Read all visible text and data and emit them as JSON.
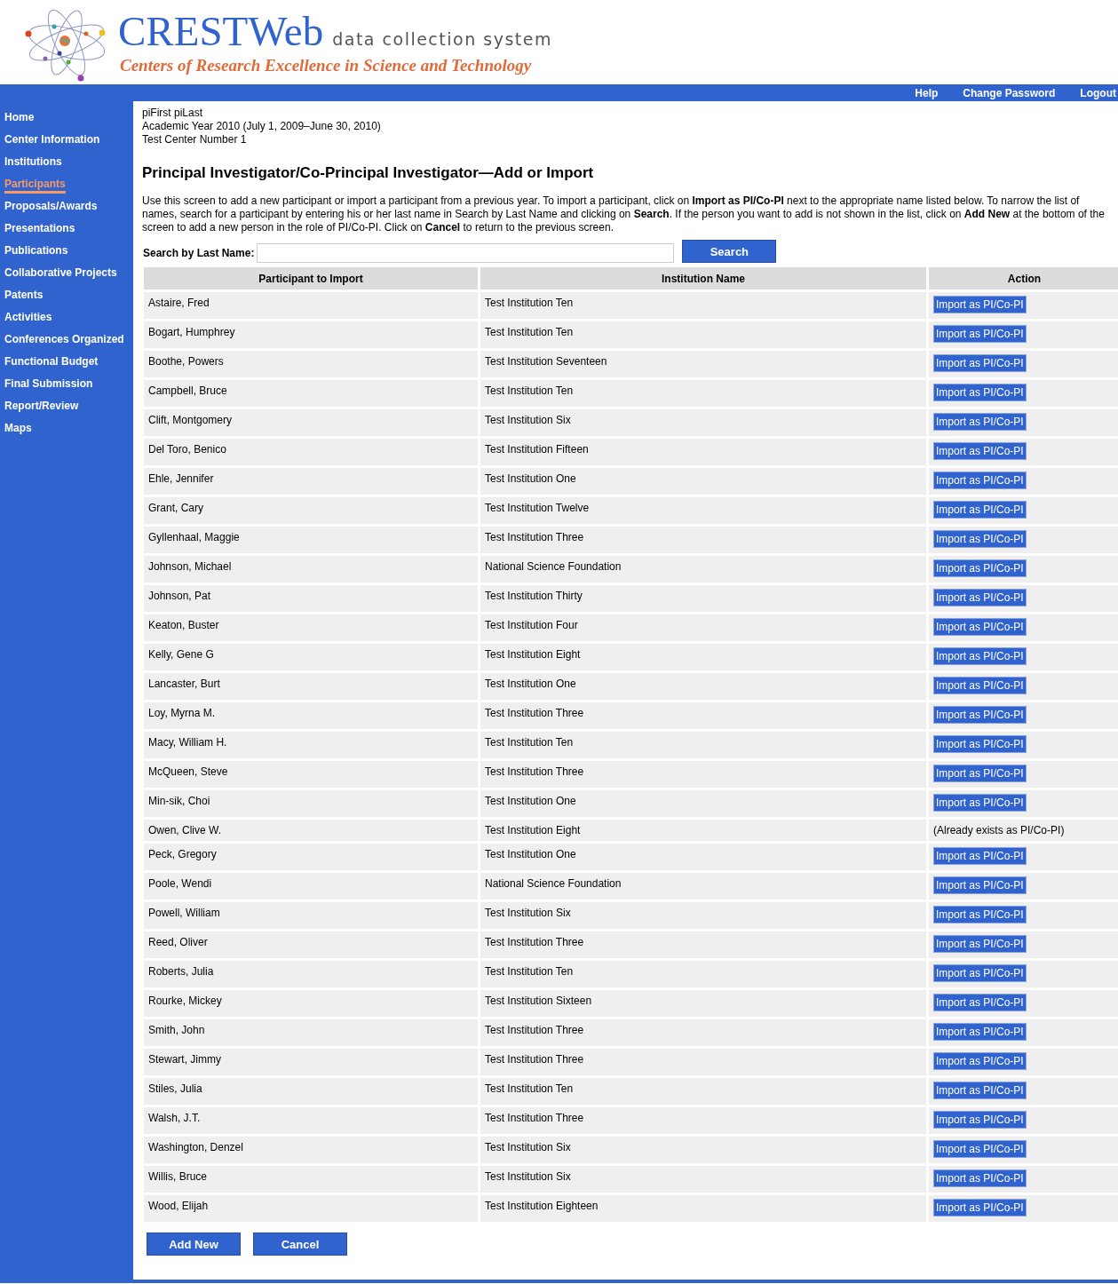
{
  "header": {
    "title": "CRESTWeb",
    "subtitle": "data collection system",
    "tagline": "Centers of Research Excellence in Science and Technology"
  },
  "top_links": [
    "Help",
    "Change Password",
    "Logout"
  ],
  "sidebar": {
    "items": [
      {
        "label": "Home",
        "selected": false
      },
      {
        "label": "Center Information",
        "selected": false
      },
      {
        "label": "Institutions",
        "selected": false
      },
      {
        "label": "Participants",
        "selected": true
      },
      {
        "label": "Proposals/Awards",
        "selected": false
      },
      {
        "label": "Presentations",
        "selected": false
      },
      {
        "label": "Publications",
        "selected": false
      },
      {
        "label": "Collaborative Projects",
        "selected": false
      },
      {
        "label": "Patents",
        "selected": false
      },
      {
        "label": "Activities",
        "selected": false
      },
      {
        "label": "Conferences Organized",
        "selected": false
      },
      {
        "label": "Functional Budget",
        "selected": false
      },
      {
        "label": "Final Submission",
        "selected": false
      },
      {
        "label": "Report/Review",
        "selected": false
      },
      {
        "label": "Maps",
        "selected": false
      }
    ]
  },
  "context": [
    "piFirst piLast",
    "Academic Year 2010 (July 1, 2009–June 30, 2010)",
    "Test Center Number 1"
  ],
  "page_title": "Principal Investigator/Co-Principal Investigator—Add or Import",
  "instructions": "Use this screen to add a new participant or import a participant from a previous year. To import a participant, click on **Import as PI/Co-PI** next to the appropriate name listed below. To narrow the list of names, search for a participant by entering his or her last name in Search by Last Name and clicking on **Search**. If the person you want to add is not shown in the list, click on **Add New** at the bottom of the screen to add a new person in the role of PI/Co-PI. Click on **Cancel** to return to the previous screen.",
  "search": {
    "label": "Search by Last Name:",
    "button": "Search"
  },
  "table": {
    "columns": [
      "Participant to Import",
      "Institution Name",
      "Action"
    ],
    "rows": [
      {
        "name": "Astaire, Fred",
        "institution": "Test Institution Ten",
        "kind": "button",
        "action": "Import as PI/Co-PI"
      },
      {
        "name": "Bogart, Humphrey",
        "institution": "Test Institution Ten",
        "kind": "button",
        "action": "Import as PI/Co-PI"
      },
      {
        "name": "Boothe, Powers",
        "institution": "Test Institution Seventeen",
        "kind": "button",
        "action": "Import as PI/Co-PI"
      },
      {
        "name": "Campbell, Bruce",
        "institution": "Test Institution Ten",
        "kind": "button",
        "action": "Import as PI/Co-PI"
      },
      {
        "name": "Clift, Montgomery",
        "institution": "Test Institution Six",
        "kind": "button",
        "action": "Import as PI/Co-PI"
      },
      {
        "name": "Del Toro, Benico",
        "institution": "Test Institution Fifteen",
        "kind": "button",
        "action": "Import as PI/Co-PI"
      },
      {
        "name": "Ehle, Jennifer",
        "institution": "Test Institution One",
        "kind": "button",
        "action": "Import as PI/Co-PI"
      },
      {
        "name": "Grant, Cary",
        "institution": "Test Institution Twelve",
        "kind": "button",
        "action": "Import as PI/Co-PI"
      },
      {
        "name": "Gyllenhaal, Maggie",
        "institution": "Test Institution Three",
        "kind": "button",
        "action": "Import as PI/Co-PI"
      },
      {
        "name": "Johnson, Michael",
        "institution": "National Science Foundation",
        "kind": "button",
        "action": "Import as PI/Co-PI"
      },
      {
        "name": "Johnson, Pat",
        "institution": "Test Institution Thirty",
        "kind": "button",
        "action": "Import as PI/Co-PI"
      },
      {
        "name": "Keaton, Buster",
        "institution": "Test Institution Four",
        "kind": "button",
        "action": "Import as PI/Co-PI"
      },
      {
        "name": "Kelly, Gene G",
        "institution": "Test Institution Eight",
        "kind": "button",
        "action": "Import as PI/Co-PI"
      },
      {
        "name": "Lancaster, Burt",
        "institution": "Test Institution One",
        "kind": "button",
        "action": "Import as PI/Co-PI"
      },
      {
        "name": "Loy, Myrna M.",
        "institution": "Test Institution Three",
        "kind": "button",
        "action": "Import as PI/Co-PI"
      },
      {
        "name": "Macy, William H.",
        "institution": "Test Institution Ten",
        "kind": "button",
        "action": "Import as PI/Co-PI"
      },
      {
        "name": "McQueen, Steve",
        "institution": "Test Institution Three",
        "kind": "button",
        "action": "Import as PI/Co-PI"
      },
      {
        "name": "Min-sik, Choi",
        "institution": "Test Institution One",
        "kind": "button",
        "action": "Import as PI/Co-PI"
      },
      {
        "name": "Owen, Clive W.",
        "institution": "Test Institution Eight",
        "kind": "note",
        "action": "(Already exists as PI/Co-PI)"
      },
      {
        "name": "Peck, Gregory",
        "institution": "Test Institution One",
        "kind": "button",
        "action": "Import as PI/Co-PI"
      },
      {
        "name": "Poole, Wendi",
        "institution": "National Science Foundation",
        "kind": "button",
        "action": "Import as PI/Co-PI"
      },
      {
        "name": "Powell, William",
        "institution": "Test Institution Six",
        "kind": "button",
        "action": "Import as PI/Co-PI"
      },
      {
        "name": "Reed, Oliver",
        "institution": "Test Institution Three",
        "kind": "button",
        "action": "Import as PI/Co-PI"
      },
      {
        "name": "Roberts, Julia",
        "institution": "Test Institution Ten",
        "kind": "button",
        "action": "Import as PI/Co-PI"
      },
      {
        "name": "Rourke, Mickey",
        "institution": "Test Institution Sixteen",
        "kind": "button",
        "action": "Import as PI/Co-PI"
      },
      {
        "name": "Smith, John",
        "institution": "Test Institution Three",
        "kind": "button",
        "action": "Import as PI/Co-PI"
      },
      {
        "name": "Stewart, Jimmy",
        "institution": "Test Institution Three",
        "kind": "button",
        "action": "Import as PI/Co-PI"
      },
      {
        "name": "Stiles, Julia",
        "institution": "Test Institution Ten",
        "kind": "button",
        "action": "Import as PI/Co-PI"
      },
      {
        "name": "Walsh, J.T.",
        "institution": "Test Institution Three",
        "kind": "button",
        "action": "Import as PI/Co-PI"
      },
      {
        "name": "Washington, Denzel",
        "institution": "Test Institution Six",
        "kind": "button",
        "action": "Import as PI/Co-PI"
      },
      {
        "name": "Willis, Bruce",
        "institution": "Test Institution Six",
        "kind": "button",
        "action": "Import as PI/Co-PI"
      },
      {
        "name": "Wood, Elijah",
        "institution": "Test Institution Eighteen",
        "kind": "button",
        "action": "Import as PI/Co-PI"
      }
    ]
  },
  "buttons": [
    "Add New",
    "Cancel"
  ]
}
